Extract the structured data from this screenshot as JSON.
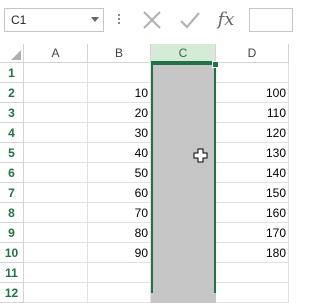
{
  "formula_bar": {
    "name_box_value": "C1",
    "cancel_icon": "cancel-x-icon",
    "enter_icon": "check-icon",
    "fx_label": "fx",
    "formula_value": ""
  },
  "columns": [
    "A",
    "B",
    "C",
    "D"
  ],
  "selected_column": "C",
  "rows": [
    {
      "num": "1",
      "A": "",
      "B": "",
      "C": "",
      "D": ""
    },
    {
      "num": "2",
      "A": "",
      "B": "10",
      "C": "",
      "D": "100"
    },
    {
      "num": "3",
      "A": "",
      "B": "20",
      "C": "",
      "D": "110"
    },
    {
      "num": "4",
      "A": "",
      "B": "30",
      "C": "",
      "D": "120"
    },
    {
      "num": "5",
      "A": "",
      "B": "40",
      "C": "",
      "D": "130"
    },
    {
      "num": "6",
      "A": "",
      "B": "50",
      "C": "",
      "D": "140"
    },
    {
      "num": "7",
      "A": "",
      "B": "60",
      "C": "",
      "D": "150"
    },
    {
      "num": "8",
      "A": "",
      "B": "70",
      "C": "",
      "D": "160"
    },
    {
      "num": "9",
      "A": "",
      "B": "80",
      "C": "",
      "D": "170"
    },
    {
      "num": "10",
      "A": "",
      "B": "90",
      "C": "",
      "D": "180"
    },
    {
      "num": "11",
      "A": "",
      "B": "",
      "C": "",
      "D": ""
    },
    {
      "num": "12",
      "A": "",
      "B": "",
      "C": "",
      "D": ""
    }
  ],
  "colors": {
    "accent": "#217346",
    "selection_fill": "#c6c6c6",
    "selected_header": "#d6ead8"
  },
  "cursor": "cell-select-plus-icon"
}
